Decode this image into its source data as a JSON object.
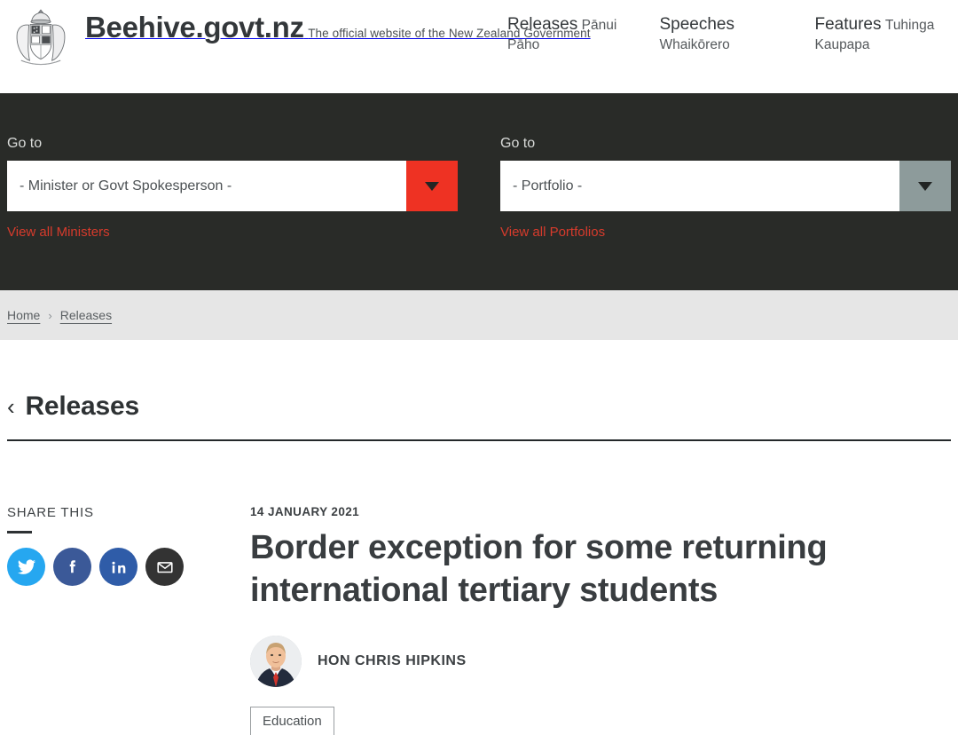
{
  "header": {
    "crest_icon": "nz-coat-of-arms",
    "brand_title": "Beehive.govt.nz",
    "brand_subtitle": "The official website of the New Zealand Government",
    "nav": [
      {
        "en": "Releases",
        "mi": "Pānui Pāho"
      },
      {
        "en": "Speeches",
        "mi": "Whaikōrero"
      },
      {
        "en": "Features",
        "mi": "Tuhinga Kaupapa"
      }
    ]
  },
  "selectors": {
    "minister": {
      "label": "Go to",
      "value": "- Minister or Govt Spokesperson -",
      "arrow_icon": "chevron-down-icon",
      "arrow_color": "#ee3223",
      "view_all": "View all Ministers"
    },
    "portfolio": {
      "label": "Go to",
      "value": "- Portfolio -",
      "arrow_icon": "chevron-down-icon",
      "arrow_color": "#8d9b9b",
      "view_all": "View all Portfolios"
    }
  },
  "breadcrumb": {
    "items": [
      "Home",
      "Releases"
    ],
    "separator": "›"
  },
  "page": {
    "back_chevron": "‹",
    "title": "Releases"
  },
  "share": {
    "label": "SHARE THIS",
    "icons": [
      {
        "name": "twitter-icon",
        "color": "#26a7f0"
      },
      {
        "name": "facebook-icon",
        "color": "#3b5998"
      },
      {
        "name": "linkedin-icon",
        "color": "#2f5ca8"
      },
      {
        "name": "email-icon",
        "color": "#333333"
      }
    ]
  },
  "article": {
    "date": "14 JANUARY 2021",
    "title": "Border exception for some returning international tertiary students",
    "author": "HON CHRIS HIPKINS",
    "author_photo_alt": "portrait-photo",
    "tags": [
      "Education"
    ]
  }
}
